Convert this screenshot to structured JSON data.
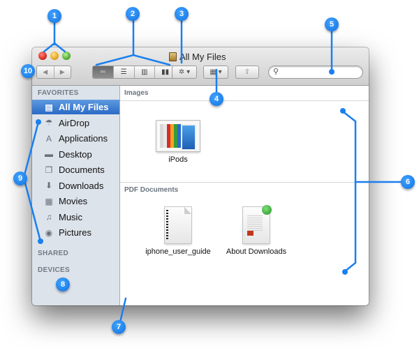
{
  "window": {
    "title": "All My Files"
  },
  "toolbar": {
    "back_icon": "◀",
    "forward_icon": "▶",
    "view_icons": [
      "▫▫",
      "☰",
      "▥",
      "▮▮"
    ],
    "view_names": [
      "icon-view",
      "list-view",
      "column-view",
      "cover-flow-view"
    ],
    "active_view": 0,
    "action_icon": "✲ ▾",
    "arrange_icon": "▦ ▾",
    "share_icon": "⇪",
    "search_placeholder": "",
    "search_value": ""
  },
  "sidebar": {
    "favorites_label": "FAVORITES",
    "shared_label": "SHARED",
    "devices_label": "DEVICES",
    "items": [
      {
        "label": "All My Files",
        "icon": "all-my-files-icon",
        "glyph": "▤",
        "selected": true
      },
      {
        "label": "AirDrop",
        "icon": "airdrop-icon",
        "glyph": "☂",
        "selected": false
      },
      {
        "label": "Applications",
        "icon": "applications-icon",
        "glyph": "A",
        "selected": false
      },
      {
        "label": "Desktop",
        "icon": "desktop-icon",
        "glyph": "▬",
        "selected": false
      },
      {
        "label": "Documents",
        "icon": "documents-icon",
        "glyph": "❐",
        "selected": false
      },
      {
        "label": "Downloads",
        "icon": "downloads-icon",
        "glyph": "⬇",
        "selected": false
      },
      {
        "label": "Movies",
        "icon": "movies-icon",
        "glyph": "▦",
        "selected": false
      },
      {
        "label": "Music",
        "icon": "music-icon",
        "glyph": "♫",
        "selected": false
      },
      {
        "label": "Pictures",
        "icon": "pictures-icon",
        "glyph": "◉",
        "selected": false
      }
    ]
  },
  "content": {
    "groups": [
      {
        "title": "Images",
        "files": [
          {
            "name": "iPods",
            "kind": "image"
          }
        ]
      },
      {
        "title": "PDF Documents",
        "files": [
          {
            "name": "iphone_user_guide",
            "kind": "pdf-spiral"
          },
          {
            "name": "About Downloads",
            "kind": "pdf-color"
          }
        ]
      }
    ]
  },
  "callouts": [
    "1",
    "2",
    "3",
    "4",
    "5",
    "6",
    "7",
    "8",
    "9",
    "10"
  ],
  "colors": {
    "callout_blue": "#1a7fef",
    "selection_blue": "#3b7bd0",
    "sidebar_bg": "#dde3ea"
  },
  "ipod_colors": [
    "#d9d9d9",
    "#e9e9e9",
    "#d92b2b",
    "#f2a51f",
    "#3a9a3a",
    "#2a6ad0",
    "#e5e5e5"
  ]
}
